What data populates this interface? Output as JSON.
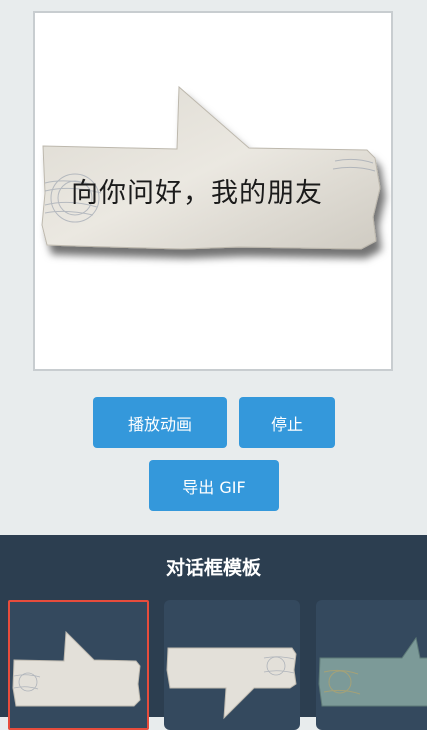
{
  "preview": {
    "bubble_text": "向你问好，我的朋友"
  },
  "buttons": {
    "play": "播放动画",
    "stop": "停止",
    "export_gif": "导出 GIF"
  },
  "templates": {
    "title": "对话框模板",
    "items": [
      {
        "style": "paper-tail-top",
        "selected": true
      },
      {
        "style": "paper-tail-bottom",
        "selected": false
      },
      {
        "style": "teal-paper",
        "selected": false
      }
    ]
  },
  "colors": {
    "accent": "#3498db",
    "panel": "#2c3e50",
    "thumb": "#34495e",
    "selected_border": "#e74c3c"
  }
}
